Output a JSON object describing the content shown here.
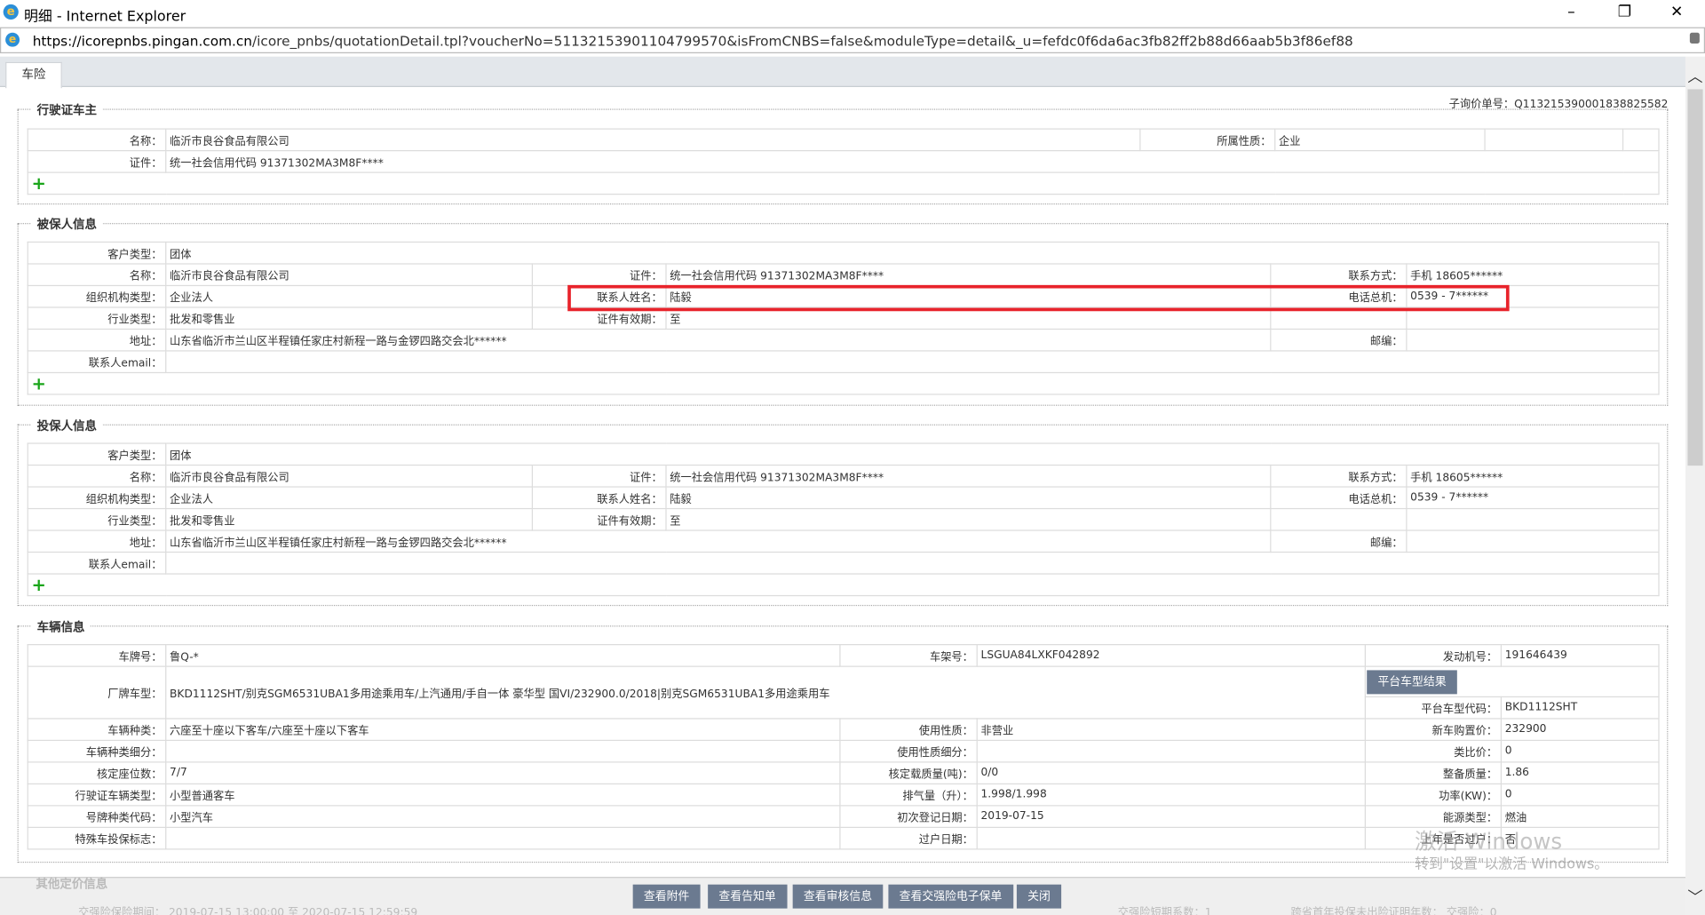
{
  "window": {
    "title": "明细 - Internet Explorer",
    "url_host": "https://icorepnbs.pingan.com.cn",
    "url_path": "/icore_pnbs/quotationDetail.tpl?voucherNo=51132153901104799570&isFromCNBS=false&moduleType=detail&_u=fefdc0f6da6ac3fb82ff2b88d66aab5b3f86ef88",
    "minimize": "–",
    "restore": "❐",
    "close": "✕"
  },
  "tab": "车险",
  "sub_quote": "子询价单号：Q113215390001838825582",
  "plus": "+",
  "owner": {
    "title": "行驶证车主",
    "f": [
      [
        "名称：",
        "临沂市良谷食品有限公司"
      ],
      [
        "所属性质：",
        "企业"
      ],
      [
        "证件：",
        "统一社会信用代码   91371302MA3M8F****"
      ]
    ]
  },
  "insured": {
    "title": "被保人信息",
    "f": [
      [
        "客户类型：",
        "团体"
      ],
      [
        "名称：",
        "临沂市良谷食品有限公司"
      ],
      [
        "证件：",
        "统一社会信用代码 91371302MA3M8F****"
      ],
      [
        "联系方式：",
        "手机 18605******"
      ],
      [
        "组织机构类型：",
        "企业法人"
      ],
      [
        "联系人姓名：",
        "陆毅"
      ],
      [
        "电话总机：",
        "0539 - 7******"
      ],
      [
        "行业类型：",
        "批发和零售业"
      ],
      [
        "证件有效期：",
        "至"
      ],
      [
        "地址：",
        "山东省临沂市兰山区半程镇任家庄村新程一路与金锣四路交会北******"
      ],
      [
        "邮编：",
        ""
      ],
      [
        "联系人email：",
        ""
      ]
    ]
  },
  "holder": {
    "title": "投保人信息",
    "f": [
      [
        "客户类型：",
        "团体"
      ],
      [
        "名称：",
        "临沂市良谷食品有限公司"
      ],
      [
        "证件：",
        "统一社会信用代码 91371302MA3M8F****"
      ],
      [
        "联系方式：",
        "手机 18605******"
      ],
      [
        "组织机构类型：",
        "企业法人"
      ],
      [
        "联系人姓名：",
        "陆毅"
      ],
      [
        "电话总机：",
        "0539 - 7******"
      ],
      [
        "行业类型：",
        "批发和零售业"
      ],
      [
        "证件有效期：",
        "至"
      ],
      [
        "地址：",
        "山东省临沂市兰山区半程镇任家庄村新程一路与金锣四路交会北******"
      ],
      [
        "邮编：",
        ""
      ],
      [
        "联系人email：",
        ""
      ]
    ]
  },
  "vehicle": {
    "title": "车辆信息",
    "platform_button": "平台车型结果",
    "f": [
      [
        "车牌号：",
        "鲁Q-*"
      ],
      [
        "车架号：",
        "LSGUA84LXKF042892"
      ],
      [
        "发动机号：",
        "191646439"
      ],
      [
        "厂牌车型：",
        "BKD1112SHT/别克SGM6531UBA1多用途乘用车/上汽通用/手自一体 豪华型 国VI/232900.0/2018|别克SGM6531UBA1多用途乘用车"
      ],
      [
        "平台车型代码：",
        "BKD1112SHT"
      ],
      [
        "车辆种类：",
        "六座至十座以下客车/六座至十座以下客车"
      ],
      [
        "使用性质：",
        "非营业"
      ],
      [
        "新车购置价：",
        "232900"
      ],
      [
        "车辆种类细分：",
        ""
      ],
      [
        "使用性质细分：",
        ""
      ],
      [
        "类比价：",
        "0"
      ],
      [
        "核定座位数：",
        "7/7"
      ],
      [
        "核定载质量(吨)：",
        "0/0"
      ],
      [
        "整备质量：",
        "1.86"
      ],
      [
        "行驶证车辆类型：",
        "小型普通客车"
      ],
      [
        "排气量（升）：",
        "1.998/1.998"
      ],
      [
        "功率(KW)：",
        "0"
      ],
      [
        "号牌种类代码：",
        "小型汽车"
      ],
      [
        "初次登记日期：",
        "2019-07-15"
      ],
      [
        "能源类型：",
        "燃油"
      ],
      [
        "特殊车投保标志：",
        ""
      ],
      [
        "过户日期：",
        ""
      ],
      [
        "上年是否过户：",
        "否"
      ]
    ]
  },
  "other": {
    "title": "其他定价信息",
    "period": "交强险保险期间：  2019-07-15 13:00:00 至 2020-07-15 12:59:59",
    "short_coef": "交强险短期系数：1",
    "cross": "跨省首年投保未出险证明年数：  交强险：0"
  },
  "buttons": [
    "查看附件",
    "查看告知单",
    "查看审核信息",
    "查看交强险电子保单",
    "关闭"
  ],
  "watermark": {
    "line1": "激活 Windows",
    "line2": "转到\"设置\"以激活 Windows。"
  }
}
